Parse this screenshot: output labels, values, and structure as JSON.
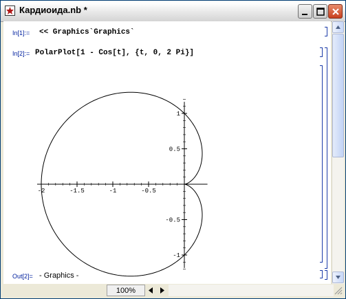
{
  "window": {
    "title": "Кардиоида.nb *"
  },
  "cells": [
    {
      "label": "In[1]:=",
      "code": "<< Graphics`Graphics`"
    },
    {
      "label": "In[2]:=",
      "code": "PolarPlot[1 - Cos[t], {t, 0, 2 Pi}]"
    }
  ],
  "output": {
    "label": "Out[2]=",
    "text": "- Graphics -"
  },
  "chart_data": {
    "type": "line",
    "title": "",
    "xlabel": "",
    "ylabel": "",
    "xlim": [
      -2,
      0.15
    ],
    "ylim": [
      -1.3,
      1.3
    ],
    "x_ticks": [
      "-2",
      "-1.5",
      "-1",
      "-0.5"
    ],
    "y_ticks": [
      "1",
      "0.5",
      "-0.5",
      "-1"
    ],
    "series": [
      {
        "function": "r = 1 - Cos[t], t in [0, 2 Pi]"
      }
    ]
  },
  "status": {
    "zoom": "100%"
  },
  "colors": {
    "label": "#00209f",
    "bracket": "#1a3aa8"
  }
}
